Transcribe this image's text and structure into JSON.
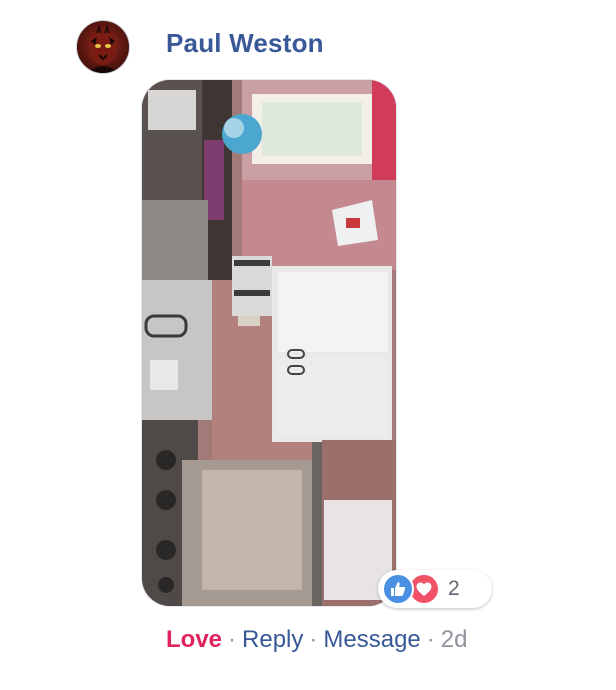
{
  "comment": {
    "author": "Paul Weston",
    "reaction_count": "2",
    "reactions": [
      "like",
      "love"
    ],
    "actions": {
      "love": "Love",
      "reply": "Reply",
      "message": "Message",
      "separator": "·",
      "timestamp": "2d"
    },
    "avatar_icon": "avatar-image",
    "photo": "kitchen-photo"
  },
  "colors": {
    "author": "#385898",
    "love_action": "#e0245e",
    "like_icon": "#4a90e2",
    "love_icon": "#f25268",
    "meta": "#90949c"
  }
}
